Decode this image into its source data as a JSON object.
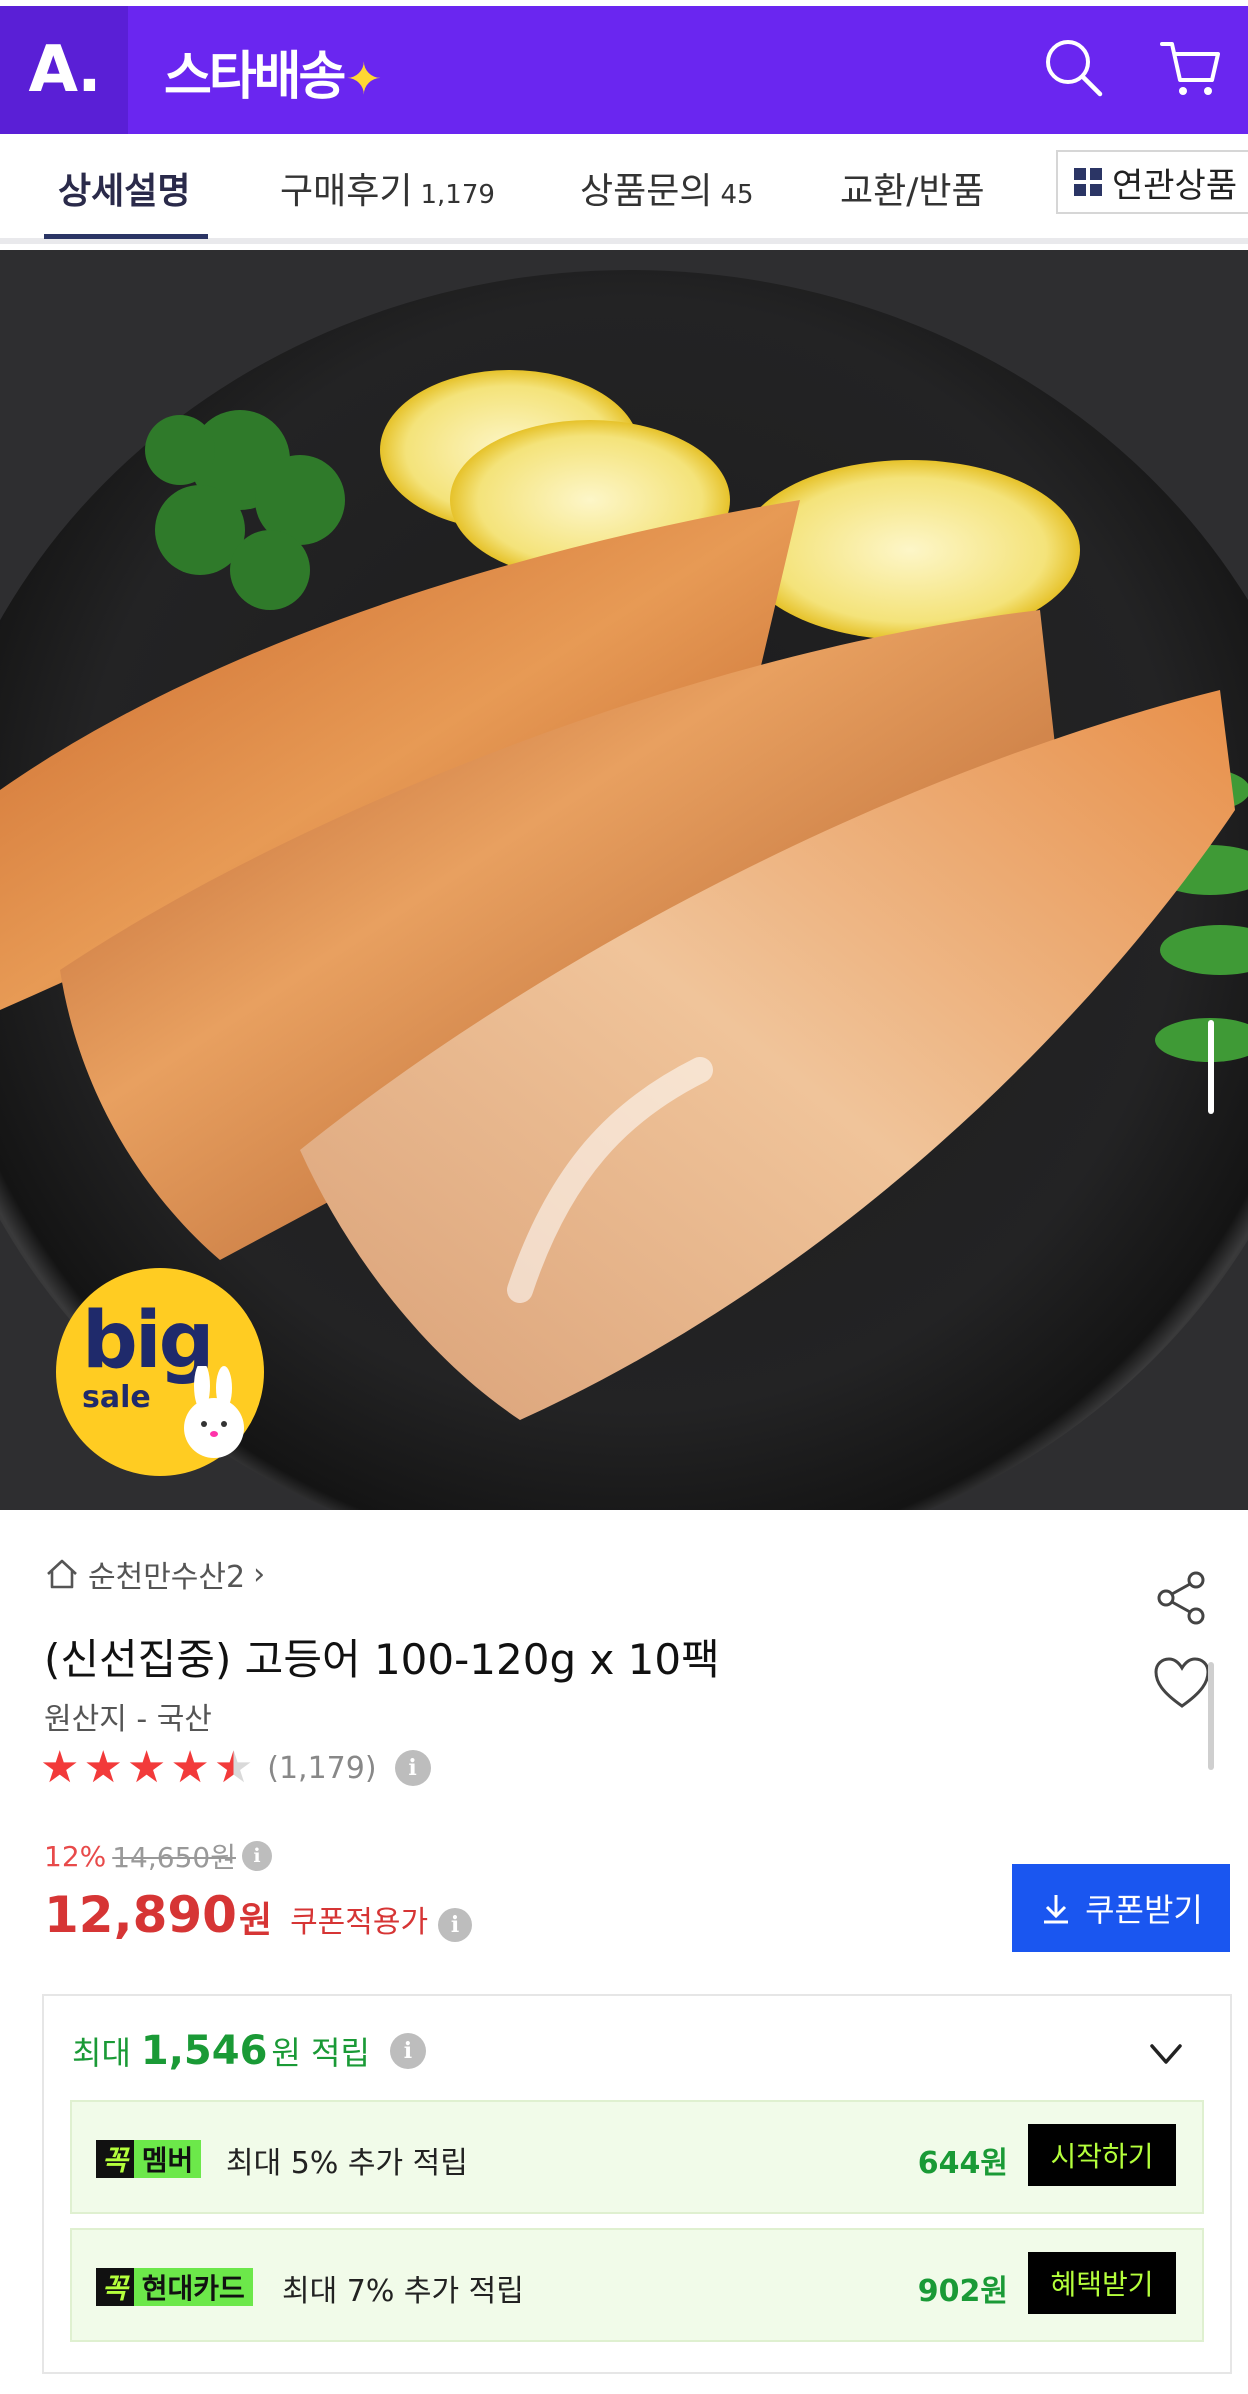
{
  "header": {
    "logo": "A.",
    "brand": "스타배송",
    "search_icon": "search-icon",
    "cart_icon": "cart-icon"
  },
  "tabs": [
    {
      "label": "상세설명",
      "count": "",
      "active": true
    },
    {
      "label": "구매후기",
      "count": "1,179",
      "active": false
    },
    {
      "label": "상품문의",
      "count": "45",
      "active": false
    },
    {
      "label": "교환/반품",
      "count": "",
      "active": false
    }
  ],
  "related": {
    "label": "연관상품",
    "icon": "grid-icon"
  },
  "hero": {
    "badge_big": "big",
    "badge_sale": "sale"
  },
  "product": {
    "shop": "순천만수산2",
    "title": "(신선집중) 고등어 100-120g x 10팩",
    "origin": "원산지 - 국산",
    "rating": 4.5,
    "rating_count": "(1,179)",
    "discount": "12%",
    "original_price": "14,650원",
    "price": "12,890",
    "price_unit": "원",
    "coupon_label": "쿠폰적용가",
    "coupon_button": "쿠폰받기"
  },
  "points": {
    "prefix": "최대",
    "amount": "1,546",
    "suffix": "원 적립",
    "benefits": [
      {
        "badge_k": "꼭",
        "badge_v": "멤버",
        "text": "최대 5% 추가 적립",
        "amount": "644원",
        "button": "시작하기"
      },
      {
        "badge_k": "꼭",
        "badge_v": "현대카드",
        "text": "최대 7% 추가 적립",
        "amount": "902원",
        "button": "혜택받기"
      }
    ]
  },
  "colors": {
    "header_purple": "#6a26f0",
    "price_red": "#d63535",
    "point_green": "#1a9a36",
    "coupon_blue": "#1a56f0"
  }
}
